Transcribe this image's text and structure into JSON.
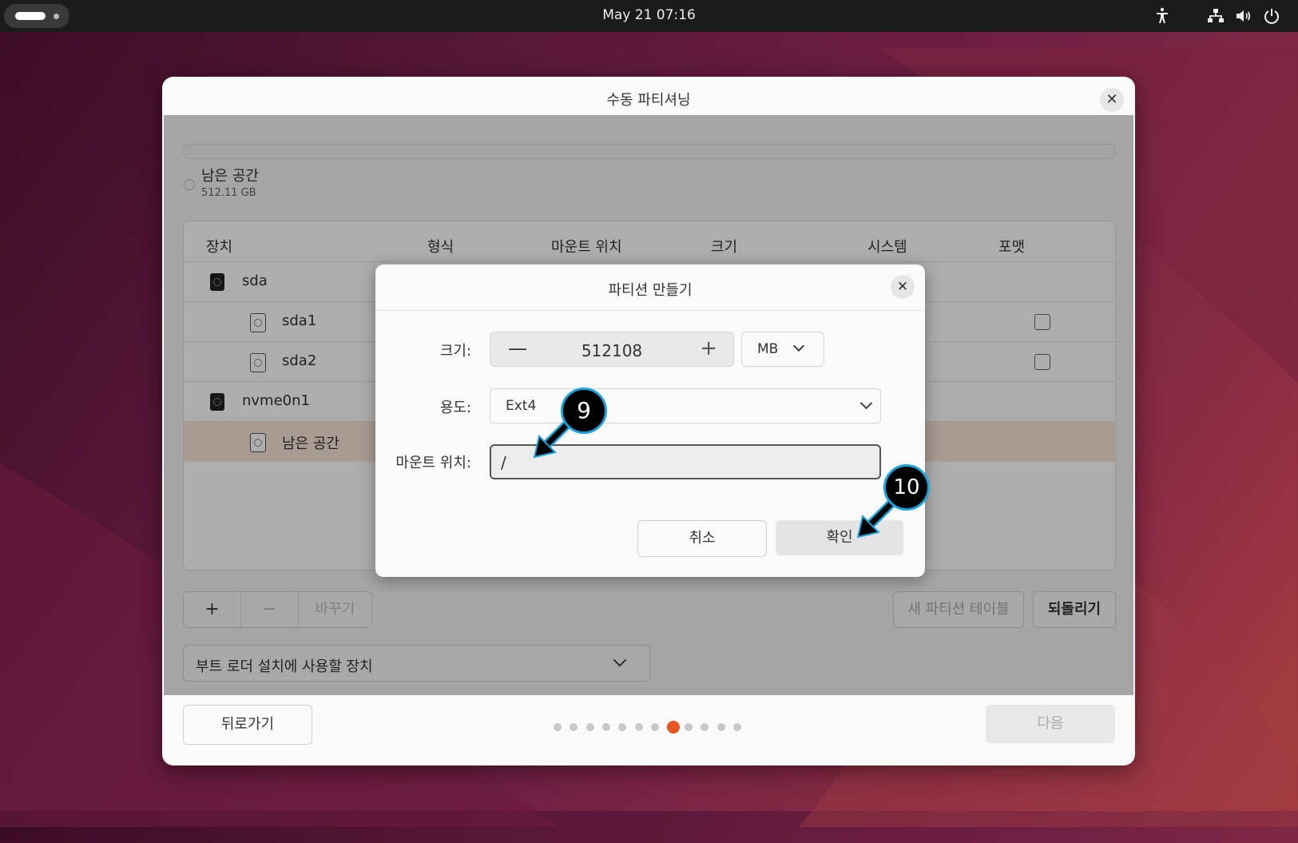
{
  "topbar": {
    "clock": "May 21  07:16",
    "icons": [
      "accessibility-icon",
      "network-icon",
      "volume-icon",
      "power-icon"
    ]
  },
  "window": {
    "title": "수동 파티셔닝",
    "free_space_label": "남은 공간",
    "free_space_size": "512.11 GB",
    "table": {
      "headers": [
        "장치",
        "형식",
        "마운트 위치",
        "크기",
        "시스템",
        "포맷"
      ],
      "rows": [
        {
          "name": "sda",
          "level": 0,
          "checkbox": false
        },
        {
          "name": "sda1",
          "level": 1,
          "checkbox": true
        },
        {
          "name": "sda2",
          "level": 1,
          "checkbox": true
        },
        {
          "name": "nvme0n1",
          "level": 0,
          "checkbox": false
        },
        {
          "name": "남은 공간",
          "level": 1,
          "checkbox": false,
          "selected": true
        }
      ]
    },
    "add_label": "+",
    "remove_label": "−",
    "change_label": "바꾸기",
    "new_table_label": "새 파티션 테이블",
    "revert_label": "되돌리기",
    "bootloader_label": "부트 로더 설치에 사용할 장치",
    "back_label": "뒤로가기",
    "next_label": "다음",
    "steps_total": 12,
    "steps_active": 8
  },
  "dialog": {
    "title": "파티션 만들기",
    "size_label": "크기:",
    "size_value": "512108",
    "unit": "MB",
    "use_label": "용도:",
    "use_value": "Ext4",
    "mount_label": "마운트 위치:",
    "mount_value": "/",
    "cancel_label": "취소",
    "ok_label": "확인"
  },
  "annotations": {
    "step9": "9",
    "step10": "10",
    "badge_color": "#1aa3d9"
  },
  "colors": {
    "accent": "#e95420",
    "selected_row": "#f6e5d8"
  }
}
